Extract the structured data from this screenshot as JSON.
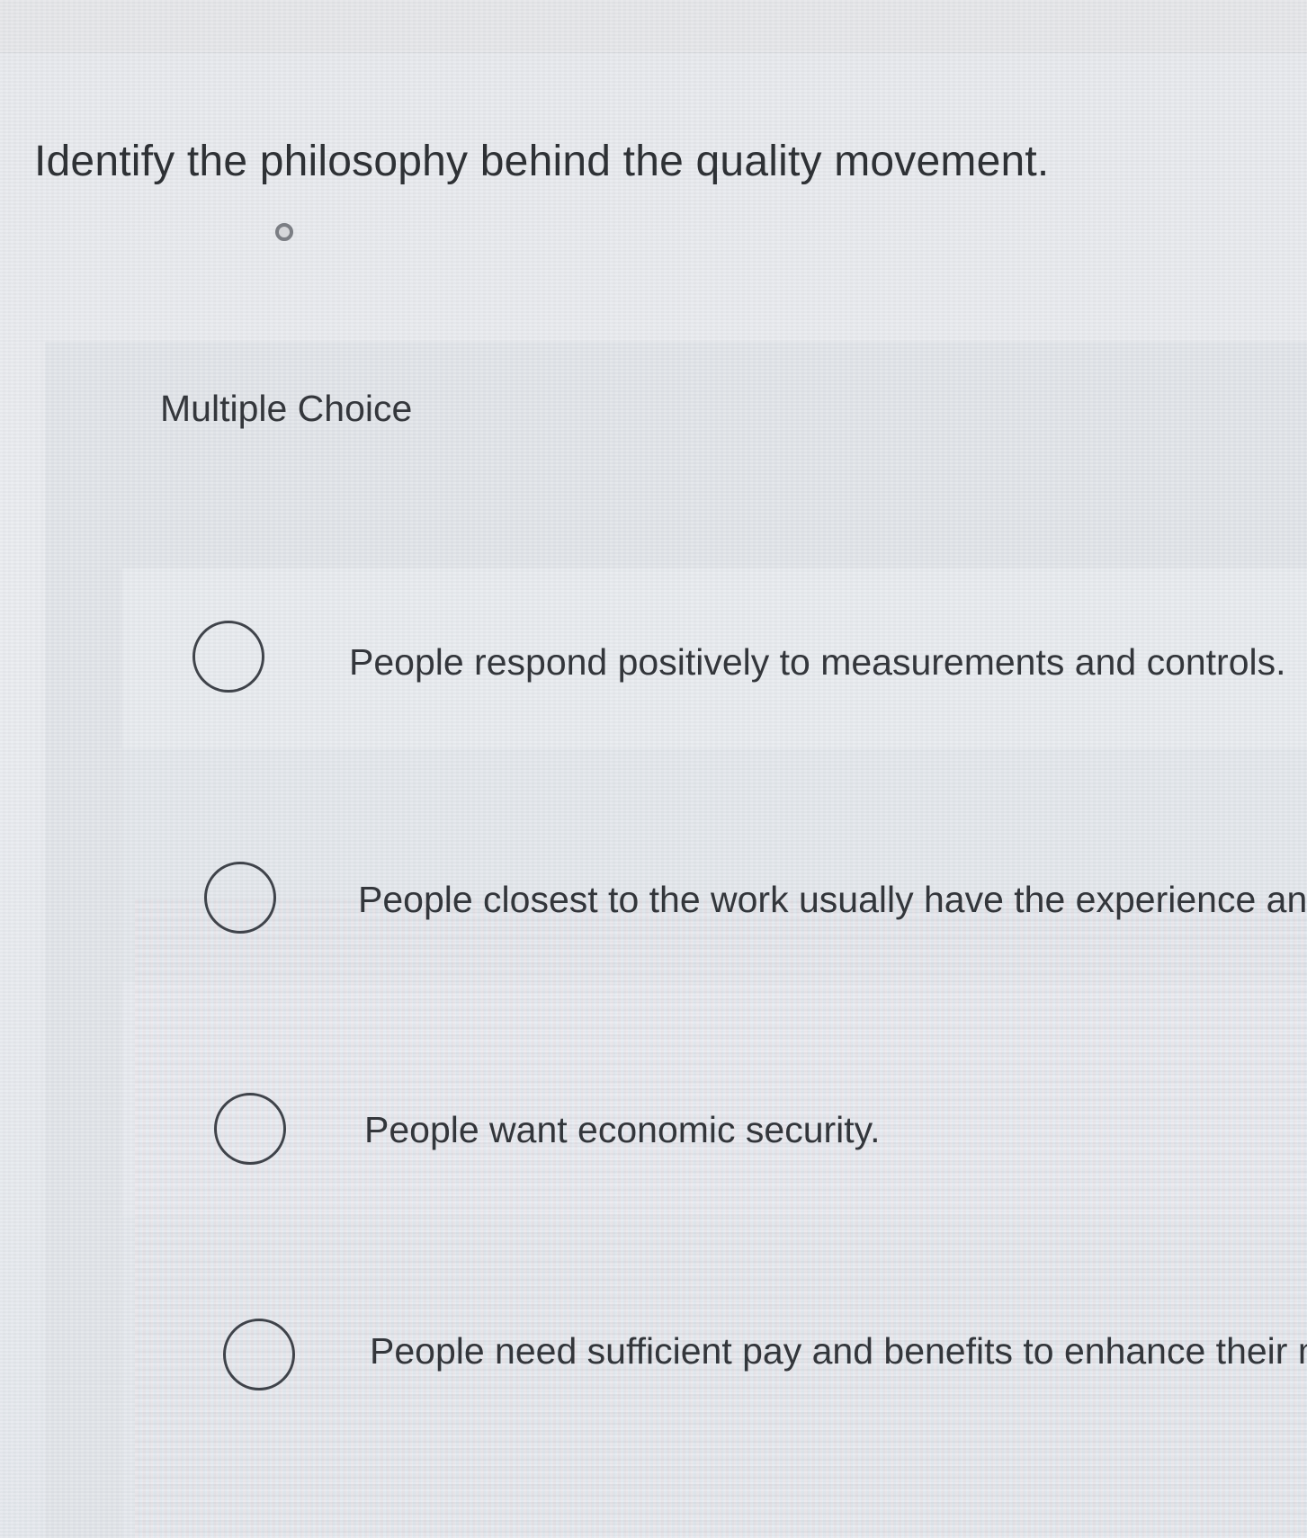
{
  "question": {
    "text": "Identify the philosophy behind the quality movement."
  },
  "question_type": {
    "label": "Multiple Choice"
  },
  "options": [
    {
      "text": "People respond positively to measurements and controls.",
      "selected": false
    },
    {
      "text": "People closest to the work usually have the experience and",
      "selected": false
    },
    {
      "text": "People want economic security.",
      "selected": false
    },
    {
      "text": "People need sufficient pay and benefits to enhance their mora",
      "selected": false
    }
  ]
}
